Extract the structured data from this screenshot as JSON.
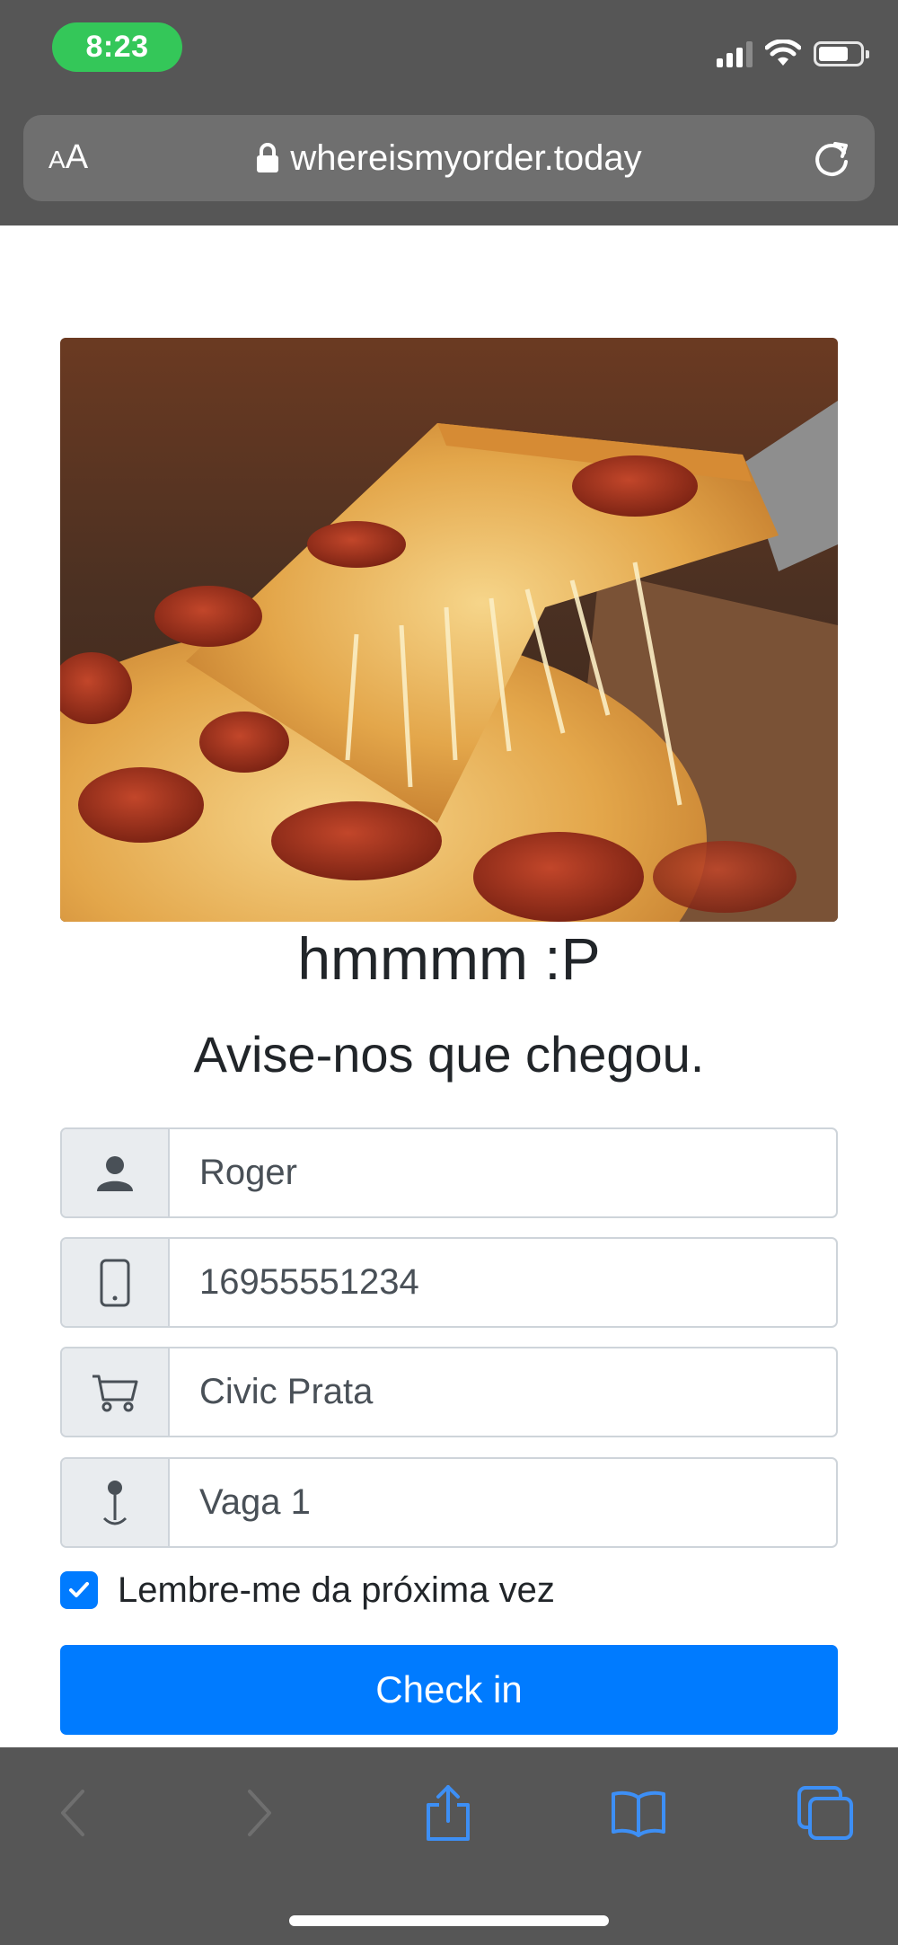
{
  "status_bar": {
    "time": "8:23"
  },
  "browser": {
    "text_size_button": "AA",
    "url": "whereismyorder.today"
  },
  "page": {
    "headline": "hmmmm :P",
    "subhead": "Avise-nos que chegou.",
    "fields": {
      "name": {
        "value": "Roger",
        "icon": "person-icon"
      },
      "phone": {
        "value": "16955551234",
        "icon": "mobile-phone-icon"
      },
      "vehicle": {
        "value": "Civic Prata",
        "icon": "cart-icon"
      },
      "spot": {
        "value": "Vaga 1",
        "icon": "map-pin-icon"
      }
    },
    "remember_label": "Lembre-me da próxima vez",
    "remember_checked": true,
    "checkin_button": "Check in",
    "colors": {
      "primary": "#007bff",
      "input_border": "#ced4da",
      "addon_background": "#e9ecef",
      "browser_chrome": "#565656",
      "clock_pill": "#34c759"
    }
  },
  "toolbar": {
    "items": [
      "back-icon",
      "forward-icon",
      "share-icon",
      "bookmarks-icon",
      "tabs-icon"
    ]
  }
}
